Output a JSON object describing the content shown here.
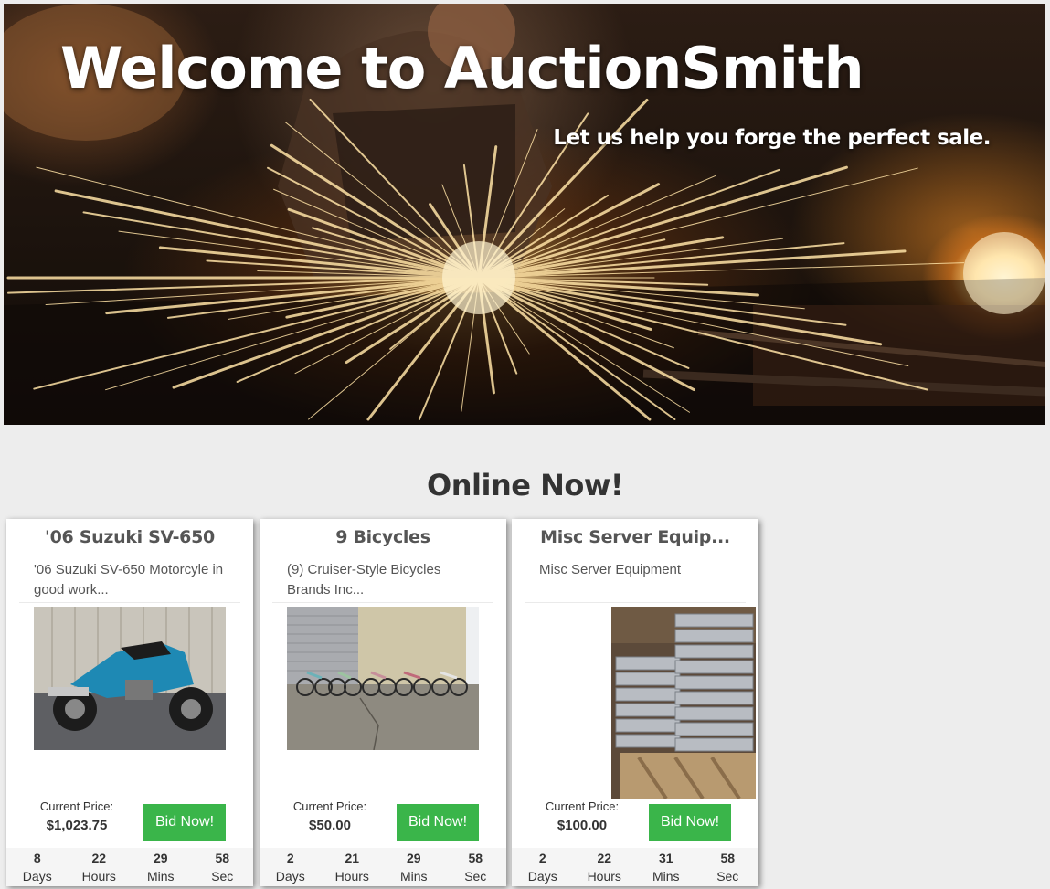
{
  "hero": {
    "title": "Welcome to AuctionSmith",
    "subtitle": "Let us help you forge the perfect sale."
  },
  "section": {
    "title": "Online Now!"
  },
  "auctions": [
    {
      "title": "'06 Suzuki SV-650",
      "description": "'06 Suzuki SV-650 Motorcyle in good work...",
      "image": "motorcycle-photo",
      "price_label": "Current Price:",
      "price": "$1,023.75",
      "bid_label": "Bid Now!",
      "timer": [
        {
          "value": "8",
          "unit": "Days"
        },
        {
          "value": "22",
          "unit": "Hours"
        },
        {
          "value": "29",
          "unit": "Mins"
        },
        {
          "value": "58",
          "unit": "Sec"
        }
      ]
    },
    {
      "title": "9 Bicycles",
      "description": "(9) Cruiser-Style Bicycles Brands Inc...",
      "image": "bicycles-photo",
      "price_label": "Current Price:",
      "price": "$50.00",
      "bid_label": "Bid Now!",
      "timer": [
        {
          "value": "2",
          "unit": "Days"
        },
        {
          "value": "21",
          "unit": "Hours"
        },
        {
          "value": "29",
          "unit": "Mins"
        },
        {
          "value": "58",
          "unit": "Sec"
        }
      ]
    },
    {
      "title": "Misc Server Equip...",
      "description": "Misc Server Equipment",
      "image": "servers-photo",
      "price_label": "Current Price:",
      "price": "$100.00",
      "bid_label": "Bid Now!",
      "timer": [
        {
          "value": "2",
          "unit": "Days"
        },
        {
          "value": "22",
          "unit": "Hours"
        },
        {
          "value": "31",
          "unit": "Mins"
        },
        {
          "value": "58",
          "unit": "Sec"
        }
      ]
    }
  ],
  "colors": {
    "bid_button": "#3ab54a",
    "page_background": "#ededed",
    "card_background": "#ffffff"
  }
}
